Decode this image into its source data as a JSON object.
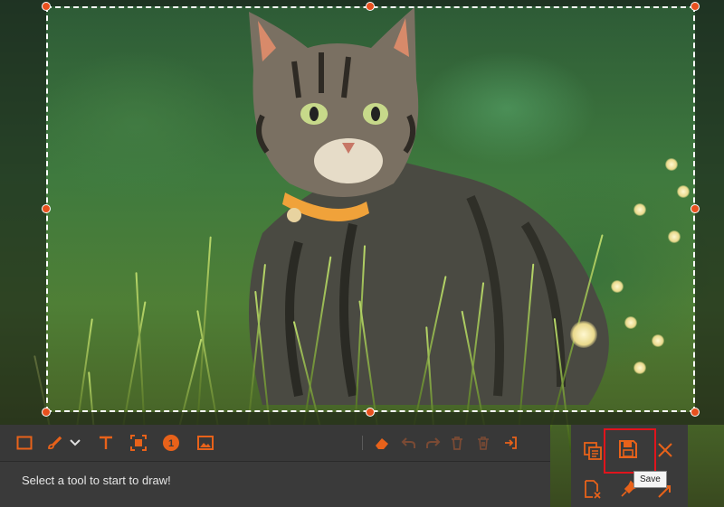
{
  "hint": {
    "text": "Select a tool to start to draw!"
  },
  "tooltip": {
    "save": "Save"
  },
  "colors": {
    "accent": "#e8621a",
    "toolbar_bg": "#3a3a3a",
    "selection_border": "#ffffff",
    "highlight": "#e0141c"
  },
  "tools": [
    {
      "name": "rectangle-icon",
      "label": "Rectangle"
    },
    {
      "name": "brush-icon",
      "label": "Brush"
    },
    {
      "name": "chevron-down-icon",
      "label": "Brush options"
    },
    {
      "name": "text-icon",
      "label": "Text"
    },
    {
      "name": "mosaic-icon",
      "label": "Mosaic"
    },
    {
      "name": "step-number-icon",
      "label": "Step"
    },
    {
      "name": "image-icon",
      "label": "Image"
    },
    {
      "name": "eraser-icon",
      "label": "Eraser"
    },
    {
      "name": "undo-icon",
      "label": "Undo"
    },
    {
      "name": "redo-icon",
      "label": "Redo"
    },
    {
      "name": "delete-icon",
      "label": "Delete"
    },
    {
      "name": "clear-all-icon",
      "label": "Clear"
    },
    {
      "name": "exit-icon",
      "label": "Exit"
    }
  ],
  "actions": [
    {
      "name": "copy-icon"
    },
    {
      "name": "save-icon"
    },
    {
      "name": "close-icon"
    },
    {
      "name": "discard-icon"
    },
    {
      "name": "pin-icon"
    },
    {
      "name": "export-icon"
    }
  ]
}
